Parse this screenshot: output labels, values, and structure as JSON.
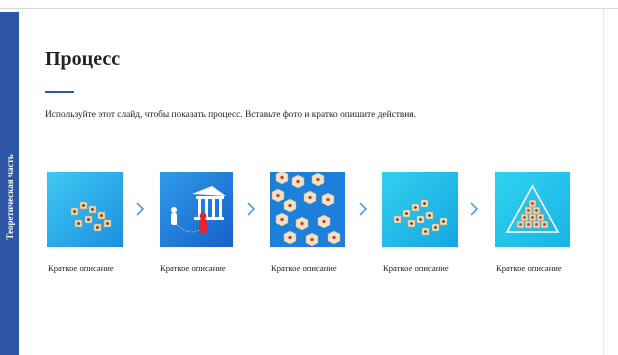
{
  "sidebar": {
    "label": "Теоретическая часть"
  },
  "slide": {
    "title": "Процесс",
    "subtitle": "Используйте этот слайд, чтобы показать процесс. Вставьте фото и кратко опишите действия."
  },
  "steps": [
    {
      "caption": "Краткое описание",
      "icon": "cube-blocks-image"
    },
    {
      "caption": "Краткое описание",
      "icon": "bank-and-figures-image"
    },
    {
      "caption": "Краткое описание",
      "icon": "people-hexagons-image"
    },
    {
      "caption": "Краткое описание",
      "icon": "cube-arrow-image"
    },
    {
      "caption": "Краткое описание",
      "icon": "pyramid-image"
    }
  ],
  "colors": {
    "accent": "#2e56a6",
    "image_blue": "#1f8fe6",
    "image_cyan": "#20c4ea",
    "arrow": "#5b9bd5"
  }
}
